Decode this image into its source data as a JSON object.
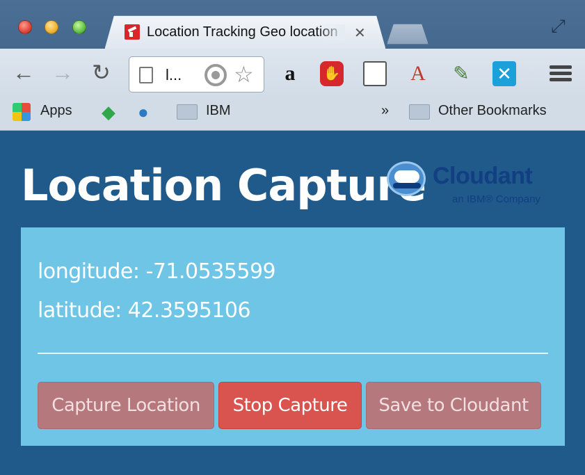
{
  "browser": {
    "tab_title": "Location Tracking Geo location",
    "tab_close": "✕",
    "address_text": "l...",
    "bookmarks": {
      "apps": "Apps",
      "ibm": "IBM",
      "overflow": "»",
      "other": "Other Bookmarks"
    }
  },
  "page": {
    "title": "Location Capture",
    "logo": {
      "name": "Cloudant",
      "subtitle": "an IBM® Company"
    },
    "longitude_label": "longitude: -71.0535599",
    "latitude_label": "latitude: 42.3595106",
    "buttons": {
      "capture": "Capture Location",
      "stop": "Stop Capture",
      "save": "Save to Cloudant"
    }
  },
  "colors": {
    "page_background": "#1f5a8b",
    "panel_background": "#6ec5e6",
    "danger_button": "#d9534f",
    "muted_button": "#b5787d",
    "logo_text": "#123e82"
  },
  "icons": {
    "back": "back-arrow-icon",
    "forward": "forward-arrow-icon",
    "reload": "reload-icon",
    "location": "location-target-icon",
    "bookmark": "star-icon",
    "menu": "hamburger-menu-icon"
  }
}
